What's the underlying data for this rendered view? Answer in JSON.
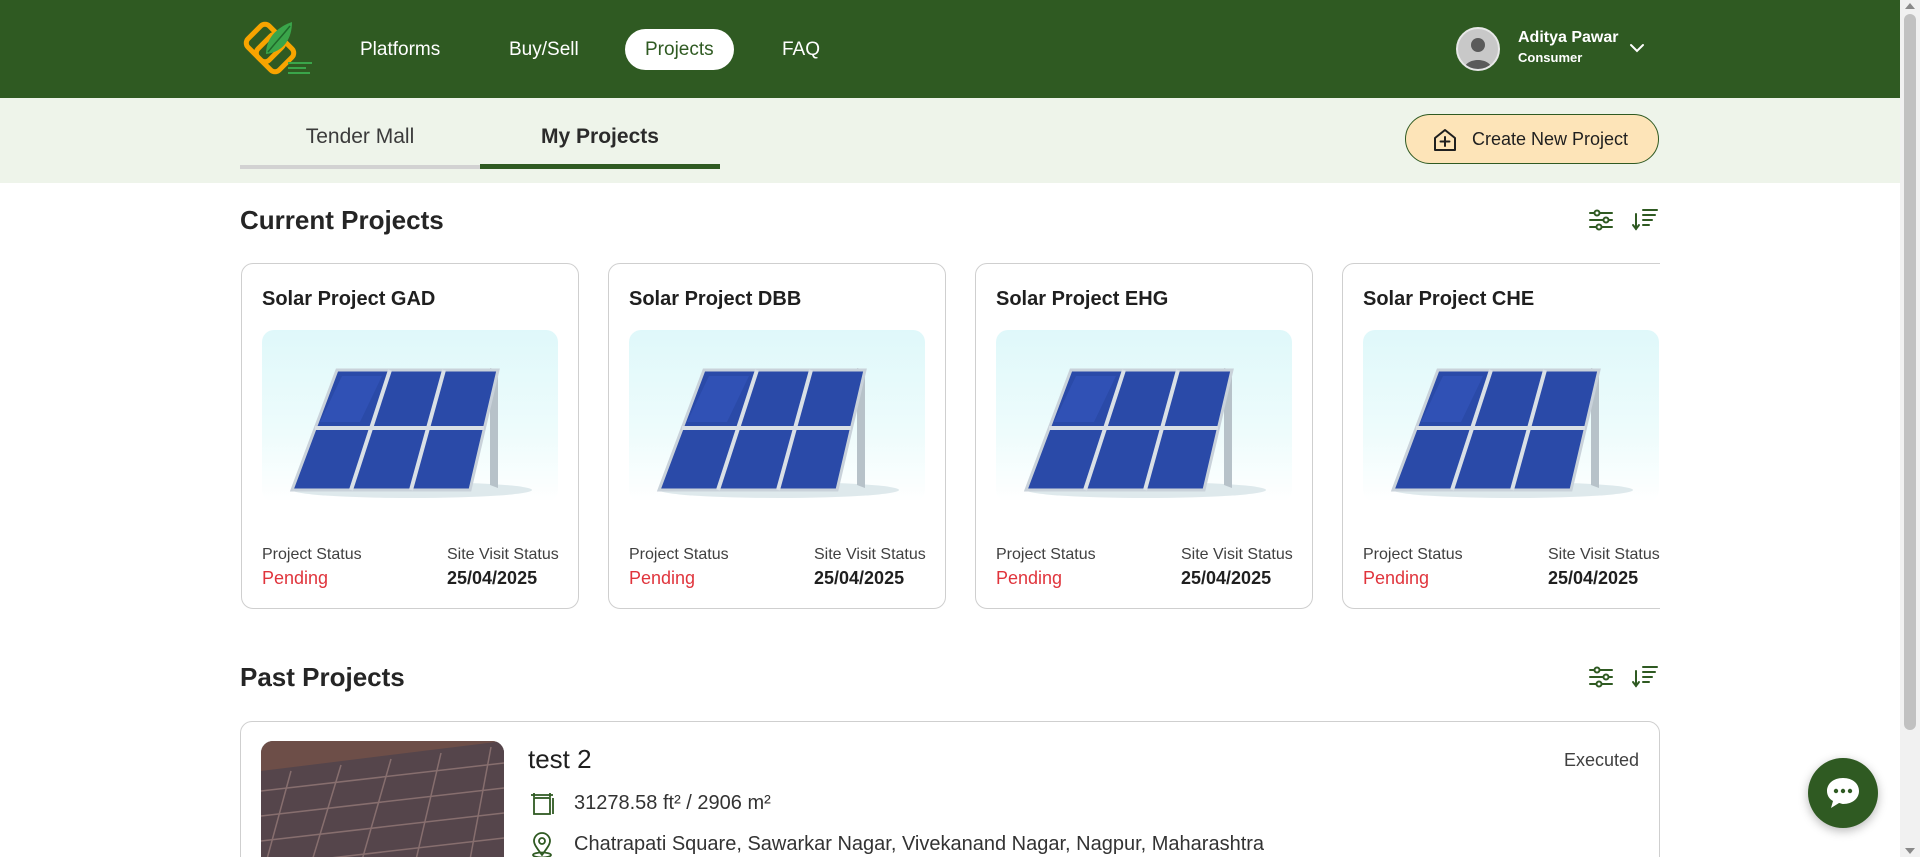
{
  "header": {
    "nav": [
      {
        "label": "Platforms",
        "active": false
      },
      {
        "label": "Buy/Sell",
        "active": false
      },
      {
        "label": "Projects",
        "active": true
      },
      {
        "label": "FAQ",
        "active": false
      }
    ],
    "user": {
      "name": "Aditya Pawar",
      "role": "Consumer"
    }
  },
  "subnav": {
    "tabs": [
      {
        "label": "Tender Mall",
        "active": false
      },
      {
        "label": "My Projects",
        "active": true
      }
    ],
    "create_button": "Create New Project"
  },
  "current_projects": {
    "title": "Current Projects",
    "cards": [
      {
        "title": "Solar Project GAD",
        "status_label": "Project Status",
        "status": "Pending",
        "visit_label": "Site Visit Status",
        "visit_date": "25/04/2025"
      },
      {
        "title": "Solar Project DBB",
        "status_label": "Project Status",
        "status": "Pending",
        "visit_label": "Site Visit Status",
        "visit_date": "25/04/2025"
      },
      {
        "title": "Solar Project EHG",
        "status_label": "Project Status",
        "status": "Pending",
        "visit_label": "Site Visit Status",
        "visit_date": "25/04/2025"
      },
      {
        "title": "Solar Project CHE",
        "status_label": "Project Status",
        "status": "Pending",
        "visit_label": "Site Visit Status",
        "visit_date": "25/04/2025"
      }
    ]
  },
  "past_projects": {
    "title": "Past Projects",
    "items": [
      {
        "title": "test 2",
        "status": "Executed",
        "area": "31278.58 ft² / 2906 m²",
        "location": "Chatrapati Square, Sawarkar Nagar, Vivekanand Nagar, Nagpur, Maharashtra"
      }
    ]
  },
  "colors": {
    "primary": "#2f5a22",
    "pending": "#e0343c",
    "cta": "#fde4b8",
    "subbar": "#eef4ea"
  },
  "icons": [
    "leaf-logo-icon",
    "user-avatar-icon",
    "chevron-down-icon",
    "house-plus-icon",
    "filter-sliders-icon",
    "sort-icon",
    "area-measure-icon",
    "location-pin-icon",
    "chat-bubble-icon"
  ]
}
